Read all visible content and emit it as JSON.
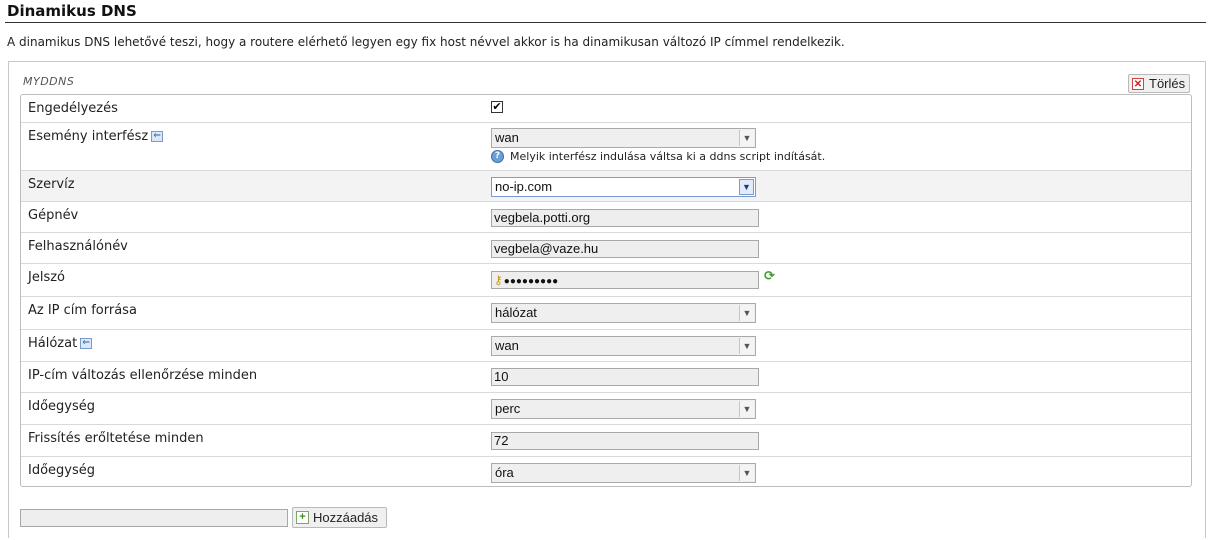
{
  "page": {
    "title": "Dinamikus DNS",
    "description": "A dinamikus DNS lehetővé teszi, hogy a routere elérhető legyen egy fix host névvel akkor is ha dinamikusan változó IP címmel rendelkezik."
  },
  "section": {
    "title": "MYDDNS",
    "delete_label": "Törlés"
  },
  "fields": {
    "enable": {
      "label": "Engedélyezés",
      "checked": true,
      "check_glyph": "✔"
    },
    "event_interface": {
      "label": "Esemény interfész",
      "value": "wan",
      "hint": "Melyik interfész indulása váltsa ki a ddns script indítását."
    },
    "service": {
      "label": "Szervíz",
      "value": "no-ip.com"
    },
    "hostname": {
      "label": "Gépnév",
      "value": "vegbela.potti.org"
    },
    "username": {
      "label": "Felhasználónév",
      "value": "vegbela@vaze.hu"
    },
    "password": {
      "label": "Jelszó",
      "value": "●●●●●●●●●"
    },
    "ip_source": {
      "label": "Az IP cím forrása",
      "value": "hálózat"
    },
    "network": {
      "label": "Hálózat",
      "value": "wan"
    },
    "check_interval": {
      "label": "IP-cím változás ellenőrzése minden",
      "value": "10"
    },
    "check_unit": {
      "label": "Időegység",
      "value": "perc"
    },
    "force_interval": {
      "label": "Frissítés erőltetése minden",
      "value": "72"
    },
    "force_unit": {
      "label": "Időegység",
      "value": "óra"
    }
  },
  "footer": {
    "add_value": "",
    "add_label": "Hozzáadás"
  },
  "icons": {
    "help": "help-icon",
    "info": "info-icon",
    "key": "key-icon",
    "reveal": "reveal-password-icon",
    "delete": "delete-icon",
    "add": "add-icon",
    "dropdown": "chevron-down-icon"
  }
}
